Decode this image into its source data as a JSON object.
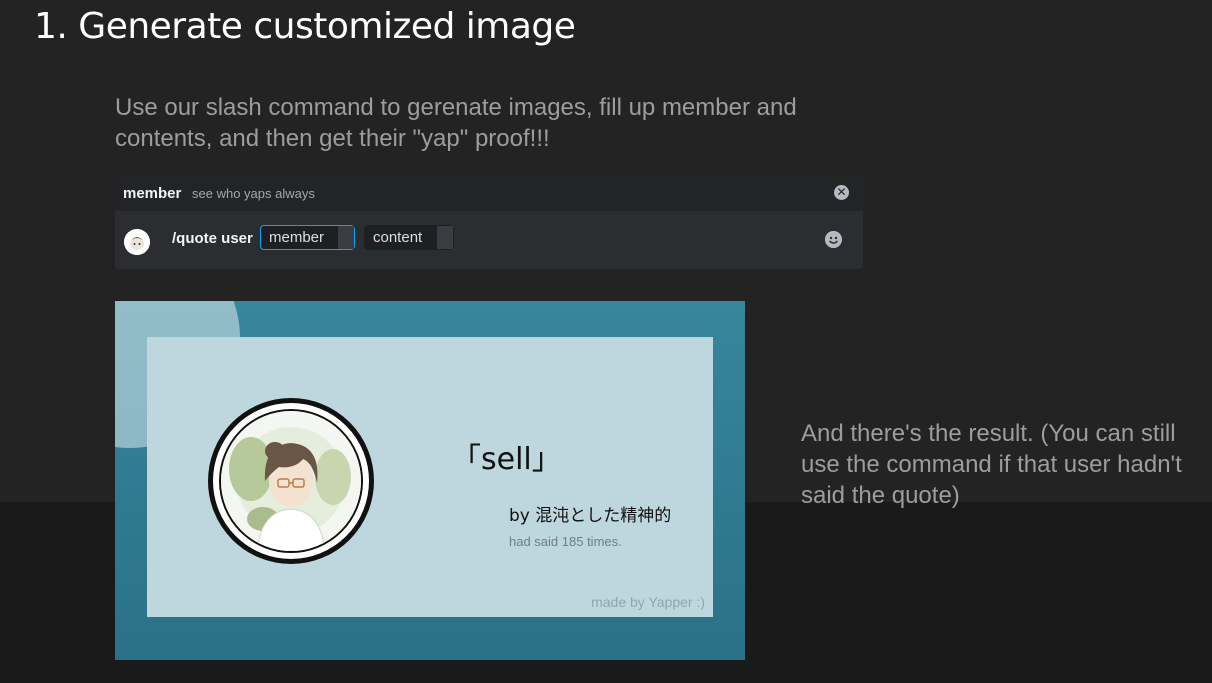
{
  "section": {
    "title": "1. Generate customized image",
    "intro": "Use our slash command to gerenate images, fill up member and contents, and then get their \"yap\" proof!!!"
  },
  "command_preview": {
    "hint_name": "member",
    "hint_description": "see who yaps always",
    "command": "/quote user",
    "options": [
      "member",
      "content"
    ],
    "icons": {
      "close": "close-circle-icon",
      "emoji": "emoji-icon",
      "app": "bot-avatar"
    },
    "accent_color": "#00a8fc"
  },
  "result_image": {
    "quote": "「sell」",
    "author": "by 混沌とした精神的",
    "count_text": "had said 185 times.",
    "watermark": "made by Yapper :)",
    "frame_color": "#317b91",
    "card_color": "#bed6de"
  },
  "result_note": "And there's the result. (You can still use the command if that user hadn't said the quote)"
}
